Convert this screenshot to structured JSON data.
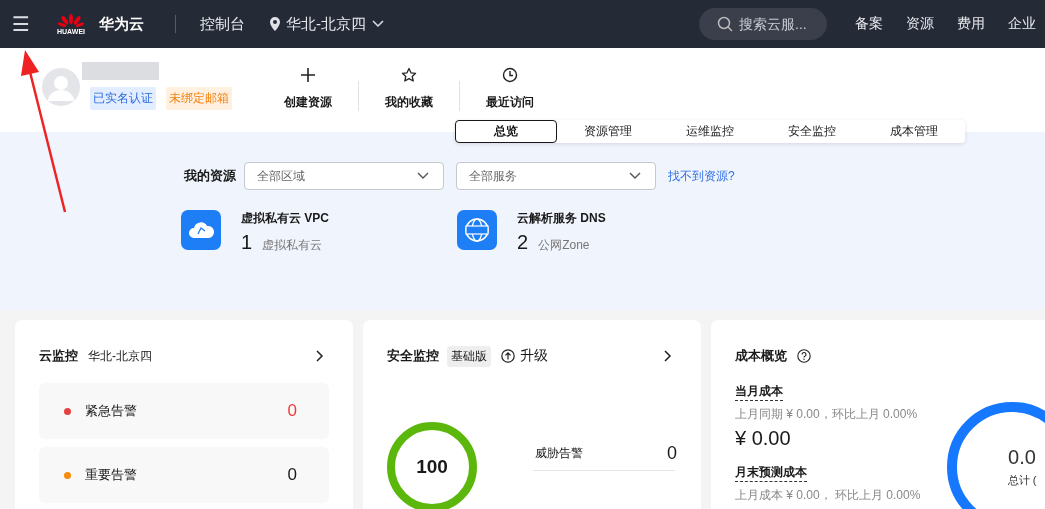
{
  "top_bar": {
    "menu": "☰",
    "brand": "华为云",
    "logo_text": "HUAWEI",
    "console": "控制台",
    "region": "华北-北京四",
    "search": {
      "placeholder": "搜索云服..."
    },
    "links": [
      "备案",
      "资源",
      "费用",
      "企业"
    ]
  },
  "profile": {
    "badges": [
      {
        "label": "已实名认证",
        "kind": "verified"
      },
      {
        "label": "未绑定邮箱",
        "kind": "warning"
      }
    ]
  },
  "quick_actions": [
    {
      "label": "创建资源",
      "kind": "plus"
    },
    {
      "label": "我的收藏",
      "kind": "star"
    },
    {
      "label": "最近访问",
      "kind": "clock"
    }
  ],
  "tabs": [
    {
      "label": "总览",
      "selected": true
    },
    {
      "label": "资源管理",
      "selected": false
    },
    {
      "label": "运维监控",
      "selected": false
    },
    {
      "label": "安全监控",
      "selected": false
    },
    {
      "label": "成本管理",
      "selected": false
    }
  ],
  "my_resources": {
    "title": "我的资源",
    "filters": [
      {
        "value": "全部区域"
      },
      {
        "value": "全部服务"
      }
    ],
    "help_link": "找不到资源?",
    "items": [
      {
        "kind": "vpc",
        "name": "虚拟私有云 VPC",
        "count": "1",
        "unit": "虚拟私有云"
      },
      {
        "kind": "dns",
        "name": "云解析服务 DNS",
        "count": "2",
        "unit": "公网Zone"
      }
    ]
  },
  "cloud_monitor": {
    "title": "云监控",
    "region": "华北-北京四",
    "alarms": [
      {
        "label": "紧急告警",
        "count": "0",
        "color": "#e84040",
        "alert": true
      },
      {
        "label": "重要告警",
        "count": "0",
        "color": "#f88a0c",
        "alert": false
      }
    ]
  },
  "security_monitor": {
    "title": "安全监控",
    "edition": "基础版",
    "upgrade": "升级",
    "score": "100",
    "threat_label": "威胁告警",
    "threat_count": "0"
  },
  "cost_overview": {
    "title": "成本概览",
    "sections": [
      {
        "label": "当月成本",
        "compare": "上月同期 ¥ 0.00，环比上月  0.00%",
        "amount": "¥ 0.00"
      },
      {
        "label": "月末预测成本",
        "compare": "上月成本 ¥ 0.00， 环比上月  0.00%"
      }
    ],
    "total_value": "0.0",
    "total_label": "总计 ("
  }
}
